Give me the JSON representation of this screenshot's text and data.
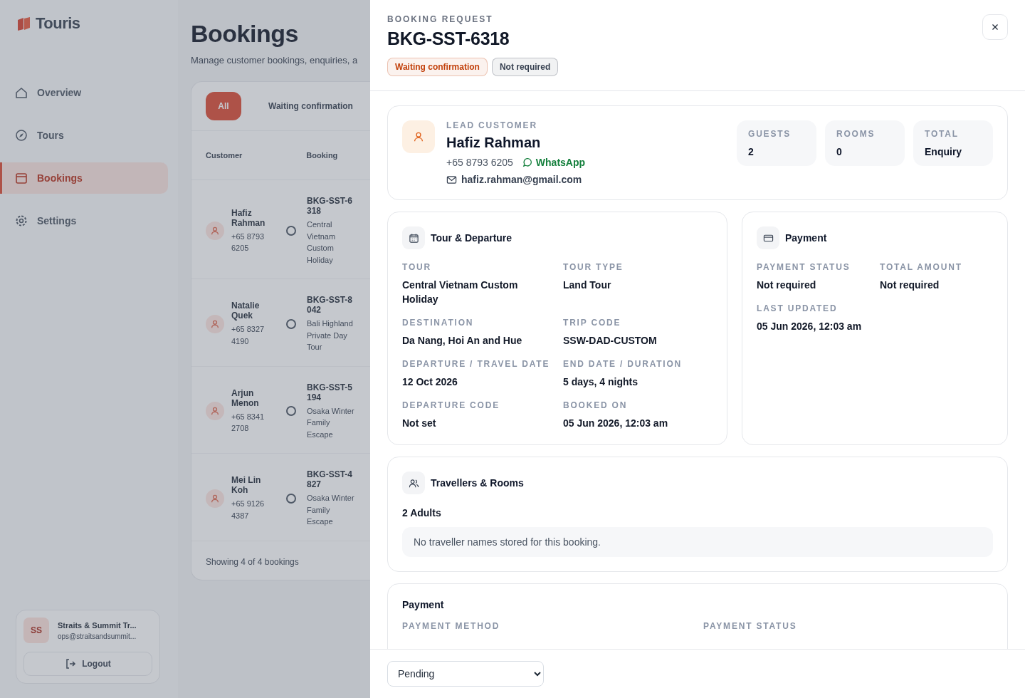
{
  "app": {
    "brand": "Touris",
    "nav": [
      {
        "label": "Overview",
        "selected": false
      },
      {
        "label": "Tours",
        "selected": false
      },
      {
        "label": "Bookings",
        "selected": true
      },
      {
        "label": "Settings",
        "selected": false
      }
    ],
    "account": {
      "initials": "SS",
      "name": "Straits & Summit Tr...",
      "email": "ops@straitsandsummit...",
      "logout": "Logout"
    }
  },
  "page": {
    "title": "Bookings",
    "subtitle": "Manage customer bookings, enquiries, a",
    "filters": [
      {
        "label": "All",
        "selected": true
      },
      {
        "label": "Waiting confirmation",
        "selected": false
      }
    ],
    "columns": [
      "Customer",
      "Booking"
    ],
    "rows": [
      {
        "name": "Hafiz Rahman",
        "phone": "+65 8793 6205",
        "code": "BKG-SST-6318",
        "tour": "Central Vietnam Custom Holiday"
      },
      {
        "name": "Natalie Quek",
        "phone": "+65 8327 4190",
        "code": "BKG-SST-8042",
        "tour": "Bali Highland Private Day Tour"
      },
      {
        "name": "Arjun Menon",
        "phone": "+65 8341 2708",
        "code": "BKG-SST-5194",
        "tour": "Osaka Winter Family Escape"
      },
      {
        "name": "Mei Lin Koh",
        "phone": "+65 9126 4387",
        "code": "BKG-SST-4827",
        "tour": "Osaka Winter Family Escape"
      }
    ],
    "footer": "Showing 4 of 4 bookings"
  },
  "drawer": {
    "eyebrow": "BOOKING REQUEST",
    "title": "BKG-SST-6318",
    "badges": [
      {
        "label": "Waiting confirmation",
        "color": "#c2410c"
      },
      {
        "label": "Not required",
        "color": "#374151"
      }
    ],
    "customer": {
      "eyebrow": "LEAD CUSTOMER",
      "name": "Hafiz Rahman",
      "phone": "+65 8793 6205",
      "whatsapp": "WhatsApp",
      "email": "hafiz.rahman@gmail.com"
    },
    "stats": [
      {
        "label": "GUESTS",
        "value": "2"
      },
      {
        "label": "ROOMS",
        "value": "0"
      },
      {
        "label": "TOTAL",
        "value": "Enquiry"
      }
    ],
    "tour": {
      "title": "Tour & Departure",
      "fields": [
        {
          "label": "TOUR",
          "value": "Central Vietnam Custom Holiday"
        },
        {
          "label": "TOUR TYPE",
          "value": "Land Tour"
        },
        {
          "label": "DESTINATION",
          "value": "Da Nang, Hoi An and Hue"
        },
        {
          "label": "TRIP CODE",
          "value": "SSW-DAD-CUSTOM"
        },
        {
          "label": "DEPARTURE / TRAVEL DATE",
          "value": "12 Oct 2026"
        },
        {
          "label": "END DATE / DURATION",
          "value": "5 days, 4 nights"
        },
        {
          "label": "DEPARTURE CODE",
          "value": "Not set"
        },
        {
          "label": "BOOKED ON",
          "value": "05 Jun 2026, 12:03 am"
        }
      ]
    },
    "payment": {
      "title": "Payment",
      "fields": [
        {
          "label": "PAYMENT STATUS",
          "value": "Not required"
        },
        {
          "label": "TOTAL AMOUNT",
          "value": "Not required"
        },
        {
          "label": "LAST UPDATED",
          "value": "05 Jun 2026, 12:03 am"
        }
      ]
    },
    "travellers": {
      "title": "Travellers & Rooms",
      "summary": "2 Adults",
      "note": "No traveller names stored for this booking."
    },
    "payment2": {
      "title": "Payment",
      "labels": [
        "PAYMENT METHOD",
        "PAYMENT STATUS"
      ]
    },
    "status_select": {
      "value": "Pending"
    }
  }
}
